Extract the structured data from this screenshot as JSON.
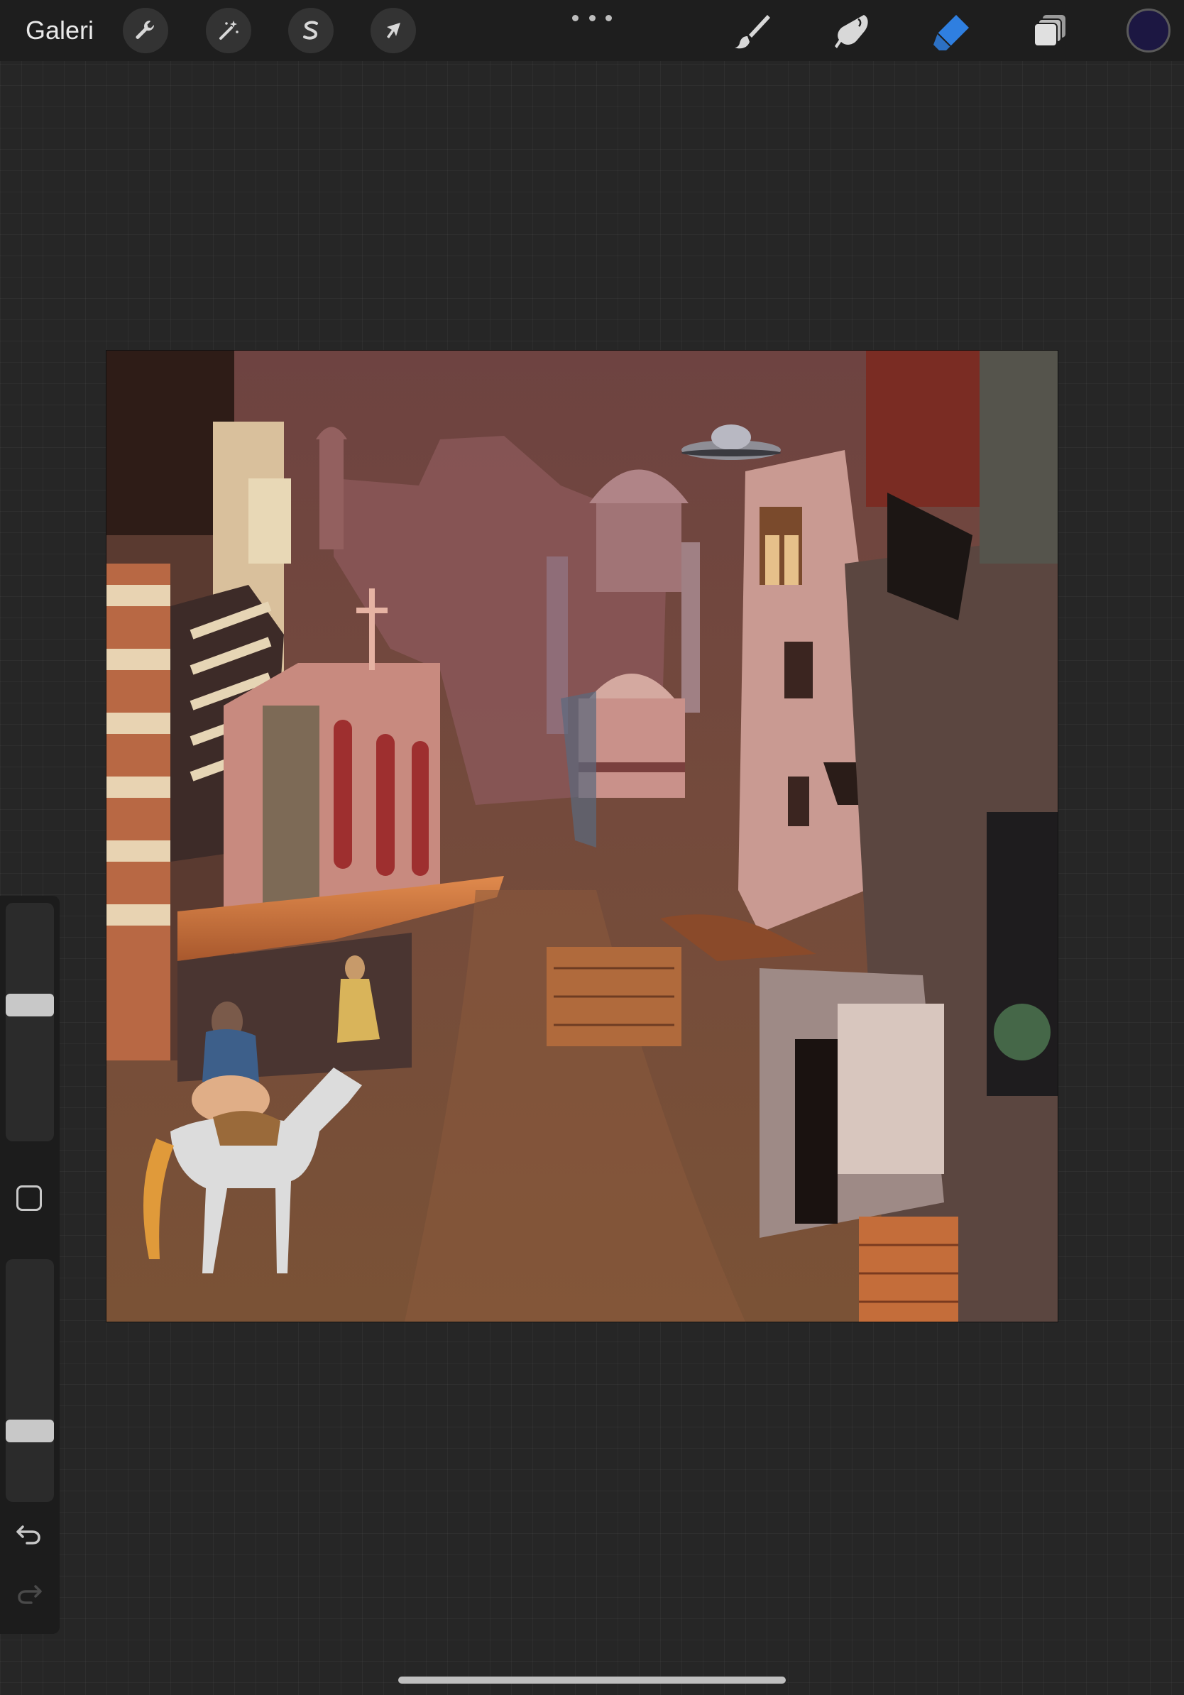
{
  "toolbar": {
    "gallery_label": "Galeri",
    "left_tools": [
      {
        "name": "actions",
        "icon": "wrench-icon"
      },
      {
        "name": "adjustments",
        "icon": "magic-wand-icon"
      },
      {
        "name": "selection",
        "icon": "selection-s-icon"
      },
      {
        "name": "transform",
        "icon": "arrow-cursor-icon"
      }
    ],
    "more_icon": "ellipsis-icon",
    "right_tools": [
      {
        "name": "brush",
        "icon": "brush-icon",
        "active": false
      },
      {
        "name": "smudge",
        "icon": "smudge-finger-icon",
        "active": false
      },
      {
        "name": "eraser",
        "icon": "eraser-icon",
        "active": true
      },
      {
        "name": "layers",
        "icon": "layers-icon",
        "active": false
      }
    ],
    "current_color": "#1c1742",
    "active_color": "#2f7fe0"
  },
  "sidebar": {
    "brush_size_level": 0.58,
    "opacity_level": 0.27,
    "modify_icon": "square-icon",
    "undo_icon": "undo-icon",
    "redo_icon": "redo-icon"
  },
  "canvas": {
    "background_color": "#6e4341",
    "artwork": "painting-of-old-street-market-with-church-mosque-horse-and-ufo"
  }
}
